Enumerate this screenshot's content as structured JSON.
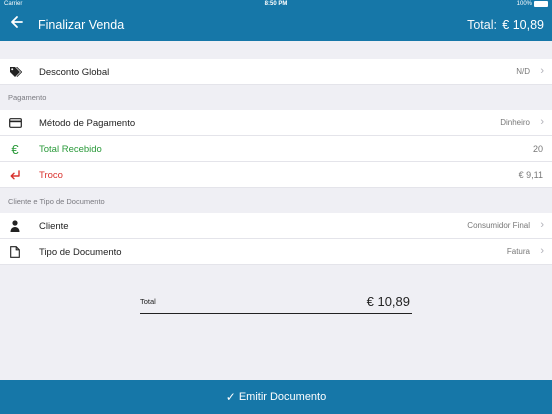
{
  "status_bar": {
    "carrier": "Carrier",
    "wifi_icon": "wifi-icon",
    "time": "8:50 PM",
    "battery": "100%"
  },
  "header": {
    "back_icon": "arrow-left-icon",
    "title": "Finalizar Venda",
    "total_label": "Total:",
    "total_value": "€ 10,89"
  },
  "discount": {
    "icon": "tags-icon",
    "label": "Desconto Global",
    "value": "N/D"
  },
  "payment_section": {
    "header": "Pagamento",
    "method": {
      "icon": "credit-card-icon",
      "label": "Método de Pagamento",
      "value": "Dinheiro"
    },
    "received": {
      "icon": "euro-icon",
      "icon_glyph": "€",
      "label": "Total Recebido",
      "value": "20",
      "color": "#2a9a3a"
    },
    "change": {
      "icon": "return-arrow-icon",
      "label": "Troco",
      "value": "€ 9,11",
      "color": "#d9322e"
    }
  },
  "client_section": {
    "header": "Cliente e Tipo de Documento",
    "client": {
      "icon": "user-icon",
      "label": "Cliente",
      "value": "Consumidor Final"
    },
    "doc_type": {
      "icon": "document-icon",
      "label": "Tipo de Documento",
      "value": "Fatura"
    }
  },
  "summary": {
    "label": "Total",
    "value": "€ 10,89"
  },
  "footer": {
    "check_icon": "checkmark-icon",
    "label": "Emitir Documento"
  },
  "colors": {
    "primary": "#1677a8",
    "background": "#efeff4",
    "green": "#2a9a3a",
    "red": "#d9322e"
  }
}
